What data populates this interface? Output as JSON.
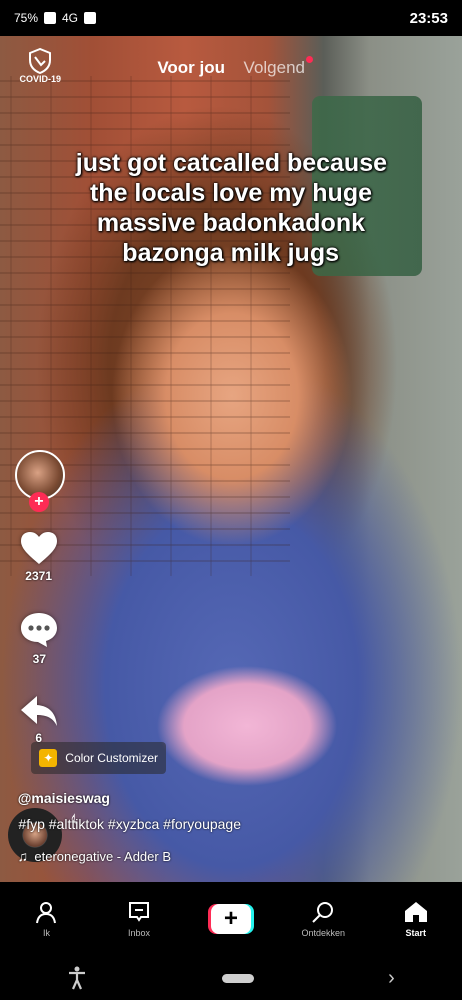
{
  "status_bar": {
    "time": "23:53",
    "battery": "75%",
    "network": "4G"
  },
  "top_tabs": {
    "following": "Volgend",
    "for_you": "Voor jou"
  },
  "covid_badge": "COVID-19",
  "caption_lines": [
    "just got catcalled because",
    "the locals love my huge",
    "massive badonkadonk",
    "bazonga milk jugs"
  ],
  "rail": {
    "likes": "2371",
    "comments": "37",
    "shares": "6"
  },
  "effect": {
    "label": "Color Customizer"
  },
  "post": {
    "username": "@maisieswag",
    "description": "#fyp #alttiktok #xyzbca #foryoupage",
    "sound": "eteronegative - Adder B"
  },
  "bottom_nav": {
    "home": "Start",
    "discover": "Ontdekken",
    "inbox": "Inbox",
    "profile": "Ik"
  },
  "colors": {
    "accent_red": "#fe2c55",
    "accent_cyan": "#25f4ee"
  }
}
